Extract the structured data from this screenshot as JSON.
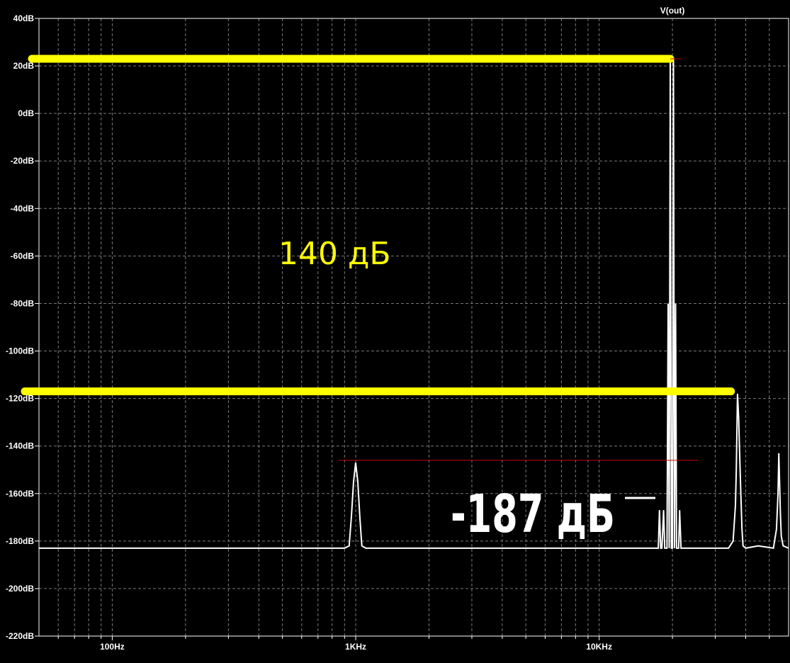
{
  "chart_data": {
    "type": "line",
    "title": "",
    "xlabel": "",
    "ylabel": "",
    "x_scale": "log",
    "xlim": [
      50,
      60000
    ],
    "ylim": [
      -220,
      40
    ],
    "grid": true,
    "y_ticks": [
      {
        "value": 40,
        "label": "40dB"
      },
      {
        "value": 20,
        "label": "20dB"
      },
      {
        "value": 0,
        "label": "0dB"
      },
      {
        "value": -20,
        "label": "-20dB"
      },
      {
        "value": -40,
        "label": "-40dB"
      },
      {
        "value": -60,
        "label": "-60dB"
      },
      {
        "value": -80,
        "label": "-80dB"
      },
      {
        "value": -100,
        "label": "-100dB"
      },
      {
        "value": -120,
        "label": "-120dB"
      },
      {
        "value": -140,
        "label": "-140dB"
      },
      {
        "value": -160,
        "label": "-160dB"
      },
      {
        "value": -180,
        "label": "-180dB"
      },
      {
        "value": -200,
        "label": "-200dB"
      },
      {
        "value": -220,
        "label": "-220dB"
      }
    ],
    "x_ticks": [
      {
        "value": 100,
        "label": "100Hz"
      },
      {
        "value": 1000,
        "label": "1KHz"
      },
      {
        "value": 10000,
        "label": "10KHz"
      }
    ],
    "series": [
      {
        "name": "V(out)",
        "color": "#ffffff",
        "x": [
          50,
          800,
          900,
          940,
          960,
          980,
          1000,
          1020,
          1040,
          1060,
          1100,
          5000,
          17500,
          17700,
          17900,
          18100,
          18400,
          18600,
          18800,
          19000,
          19200,
          19400,
          19600,
          19800,
          20000,
          20200,
          20400,
          20600,
          20800,
          21000,
          21200,
          21400,
          21700,
          22000,
          25000,
          34000,
          35500,
          36300,
          36600,
          37000,
          37400,
          37800,
          38200,
          38600,
          39000,
          40000,
          45000,
          52000,
          53500,
          54300,
          54700,
          55100,
          55500,
          56000,
          57000,
          60000
        ],
        "y": [
          -183,
          -183,
          -183,
          -182,
          -170,
          -155,
          -147,
          -155,
          -170,
          -182,
          -183,
          -183,
          -183,
          -167,
          -183,
          -183,
          -167,
          -183,
          -183,
          -183,
          -80,
          -183,
          23,
          -183,
          -183,
          23,
          -183,
          -80,
          -183,
          -183,
          -183,
          -167,
          -183,
          -183,
          -183,
          -183,
          -180,
          -165,
          -150,
          -118,
          -128,
          -145,
          -160,
          -175,
          -182,
          -183,
          -182,
          -183,
          -175,
          -160,
          -143,
          -155,
          -168,
          -178,
          -182,
          -183
        ]
      }
    ],
    "annotations": [
      {
        "text": "140 дБ",
        "color": "#ffff00"
      },
      {
        "text": "-187 дБ",
        "color": "#ffffff"
      }
    ],
    "reference_lines": [
      {
        "value": 23,
        "color": "#ffff00"
      },
      {
        "value": -117,
        "color": "#ffff00"
      },
      {
        "value": -146,
        "color": "#cc0000"
      }
    ]
  }
}
